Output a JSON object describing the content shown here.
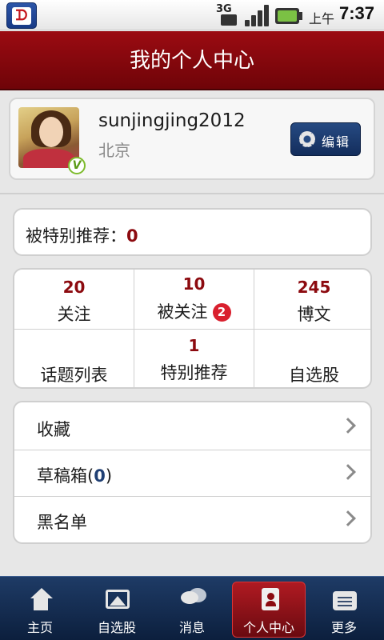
{
  "status_bar": {
    "network": "3G",
    "ampm": "上午",
    "time": "7:37"
  },
  "header": {
    "title": "我的个人中心"
  },
  "profile": {
    "username": "sunjingjing2012",
    "location": "北京",
    "verified_badge": "V",
    "edit_label": "编辑"
  },
  "recommend": {
    "label": "被特别推荐：",
    "value": "0"
  },
  "stats": {
    "follow": {
      "count": "20",
      "label": "关注"
    },
    "followers": {
      "count": "10",
      "label": "被关注",
      "badge": "2"
    },
    "posts": {
      "count": "245",
      "label": "博文"
    },
    "topics": {
      "label": "话题列表"
    },
    "special": {
      "count": "1",
      "label": "特别推荐"
    },
    "stocks": {
      "label": "自选股"
    }
  },
  "menu": {
    "favorites": "收藏",
    "drafts": "草稿箱",
    "drafts_open": "(",
    "drafts_count": "0",
    "drafts_close": ")",
    "blacklist": "黑名单"
  },
  "tabs": {
    "home": "主页",
    "stocks": "自选股",
    "messages": "消息",
    "profile": "个人中心",
    "more": "更多"
  },
  "colors": {
    "brand_red": "#8c0a0f",
    "nav_blue": "#1e3b66",
    "badge_red": "#d9202e"
  }
}
